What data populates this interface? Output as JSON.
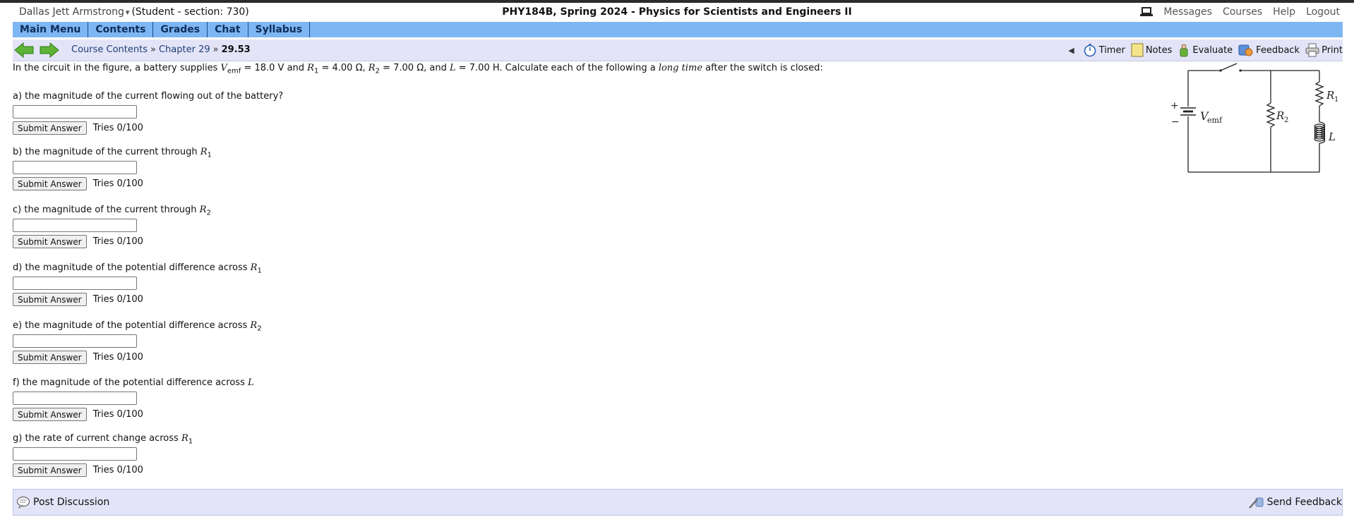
{
  "header": {
    "user_name": "Dallas Jett Armstrong",
    "user_role": "(Student  - section: 730)",
    "course_title": "PHY184B, Spring 2024 - Physics for Scientists and Engineers II",
    "links": {
      "messages": "Messages",
      "courses": "Courses",
      "help": "Help",
      "logout": "Logout"
    }
  },
  "main_nav": {
    "items": [
      "Main Menu",
      "Contents",
      "Grades",
      "Chat",
      "Syllabus"
    ]
  },
  "breadcrumb": {
    "course_contents": "Course Contents",
    "separator": "»",
    "chapter": "Chapter 29",
    "current": "29.53"
  },
  "toolbar": {
    "timer": "Timer",
    "notes": "Notes",
    "evaluate": "Evaluate",
    "feedback": "Feedback",
    "print": "Print"
  },
  "problem": {
    "intro_1": "In the circuit in the figure, a battery supplies ",
    "V": "V",
    "emf_sub": "emf",
    "intro_2": " = 18.0 V and ",
    "R": "R",
    "sub_1": "1",
    "intro_3": " = 4.00 Ω, ",
    "sub_2": "2",
    "intro_4": " = 7.00 Ω, and ",
    "L": "L",
    "intro_5": " = 7.00 H. Calculate each of the following a ",
    "long_time": "long time",
    "intro_6": " after the switch is closed:"
  },
  "questions": [
    {
      "label": "a) the magnitude of the current flowing out of the battery?",
      "var": "",
      "sub": "",
      "value": "",
      "submit_label": "Submit Answer",
      "tries": "Tries 0/100"
    },
    {
      "label": "b) the magnitude of the current through ",
      "var": "R",
      "sub": "1",
      "value": "",
      "submit_label": "Submit Answer",
      "tries": "Tries 0/100"
    },
    {
      "label": "c) the magnitude of the current through ",
      "var": "R",
      "sub": "2",
      "value": "",
      "submit_label": "Submit Answer",
      "tries": "Tries 0/100"
    },
    {
      "label": "d) the magnitude of the potential difference across ",
      "var": "R",
      "sub": "1",
      "value": "",
      "submit_label": "Submit Answer",
      "tries": "Tries 0/100"
    },
    {
      "label": "e) the magnitude of the potential difference across ",
      "var": "R",
      "sub": "2",
      "value": "",
      "submit_label": "Submit Answer",
      "tries": "Tries 0/100"
    },
    {
      "label": "f) the magnitude of the potential difference across ",
      "var": "L",
      "sub": "",
      "value": "",
      "submit_label": "Submit Answer",
      "tries": "Tries 0/100"
    },
    {
      "label": "g) the rate of current change across ",
      "var": "R",
      "sub": "1",
      "value": "",
      "submit_label": "Submit Answer",
      "tries": "Tries 0/100"
    }
  ],
  "circuit_labels": {
    "plus": "+",
    "minus": "−",
    "v": "V",
    "emf": "emf",
    "r": "R",
    "one": "1",
    "two": "2",
    "l": "L"
  },
  "footer": {
    "post_discussion": "Post Discussion",
    "send_feedback": "Send Feedback"
  },
  "colors": {
    "main_nav_bg": "#7eb6f4",
    "subnav_bg": "#e4e4f8",
    "nav_text": "#0e2e5a",
    "arrow_green": "#5fb336"
  }
}
